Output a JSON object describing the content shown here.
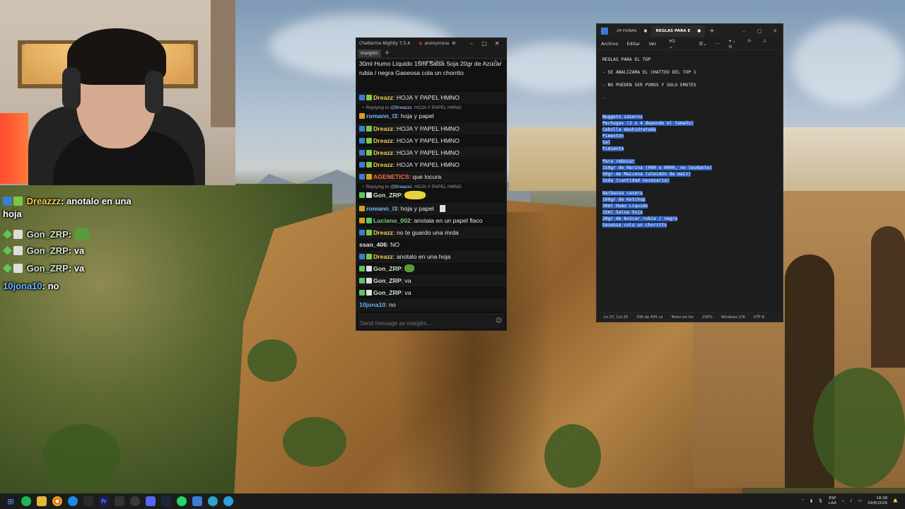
{
  "overlay_chat": {
    "lines": [
      {
        "user": "Dreazzz",
        "text": ": anotalo en una",
        "user_color": "#f0d050"
      },
      {
        "text": "hoja"
      },
      {
        "user": "Gon_ZRP",
        "text": ":",
        "user_color": "#cfe8cf"
      },
      {
        "user": "Gon_ZRP",
        "text": ": va",
        "user_color": "#cfe8cf"
      },
      {
        "user": "Gon_ZRP",
        "text": ": va",
        "user_color": "#cfe8cf"
      },
      {
        "user": "10jona10",
        "text": ": no",
        "user_color": "#6ab0ff"
      }
    ]
  },
  "chatterino": {
    "title": "Chatterino Nightly 7.5.4",
    "account": "anonymous",
    "tab": "margiim",
    "channel_header": "margiim (live)",
    "pinned_text": "30ml Humo Líquido 15ml Salsa Soja 20gr de Azúcar rubia / negra Gaseosa cola un chorrito",
    "input_placeholder": "Send message as margiim...",
    "messages": [
      {
        "user": "Dreazz",
        "text": ": HOJA Y PAPEL HMNO",
        "color": "#f0d050"
      },
      {
        "reply_to": "@Dreazzz",
        "reply_text": "HOJA Y PAPEL HMNO"
      },
      {
        "user": "romann_l3",
        "text": ": hoja y papel",
        "color": "#7ab8ff"
      },
      {
        "user": "Dreazz",
        "text": ": HOJA Y PAPEL HMNO",
        "color": "#f0d050"
      },
      {
        "user": "Dreazz",
        "text": ": HOJA Y PAPEL HMNO",
        "color": "#f0d050"
      },
      {
        "user": "Dreazz",
        "text": ": HOJA Y PAPEL HMNO",
        "color": "#f0d050"
      },
      {
        "user": "Dreazz",
        "text": ": HOJA Y PAPEL HMNO",
        "color": "#f0d050"
      },
      {
        "user": "AGENETICS",
        "text": ": que locura",
        "color": "#ff6a3d"
      },
      {
        "reply_to": "@Dreazzz",
        "reply_text": "HOJA Y PAPEL HMNO"
      },
      {
        "user": "Gon_ZRP",
        "text": ":",
        "color": "#cfe8cf"
      },
      {
        "user": "romann_l3",
        "text": ": hoja y papel",
        "color": "#7ab8ff"
      },
      {
        "user": "Luciano_002",
        "text": ": anotala en un papel flaco",
        "color": "#7fd07f"
      },
      {
        "user": "Dreazz",
        "text": ": no te guardo una mrda",
        "color": "#f0d050"
      },
      {
        "user": "ssan_406",
        "text": ": NO",
        "color": "#e6e6e6"
      },
      {
        "user": "Dreazz",
        "text": ": anotalo en una hoja",
        "color": "#f0d050"
      },
      {
        "user": "Gon_ZRP",
        "text": ":",
        "color": "#cfe8cf"
      },
      {
        "user": "Gon_ZRP",
        "text": ": va",
        "color": "#cfe8cf"
      },
      {
        "user": "Gon_ZRP",
        "text": ": va",
        "color": "#cfe8cf"
      },
      {
        "user": "10jona10",
        "text": ": no",
        "color": "#6ab0ff"
      }
    ]
  },
  "notepad": {
    "tabs": [
      "24 HORAS",
      "REGLAS PARA E"
    ],
    "menu": [
      "Archivo",
      "Editar",
      "Ver"
    ],
    "heading_level": "H1",
    "lines": [
      {
        "text": "REGLAS PARA EL TOP",
        "sel": false
      },
      {
        "text": "",
        "sel": false
      },
      {
        "text": "- SE ANALIZARA EL CHATTEO DEL TOP 1",
        "sel": false
      },
      {
        "text": "",
        "sel": false
      },
      {
        "text": "- NO PUEDEN SER PUROS Y SOLO EMOTES",
        "sel": false
      },
      {
        "text": "",
        "sel": false
      },
      {
        "text": "-",
        "sel": false
      },
      {
        "text": "",
        "sel": false
      },
      {
        "text": "",
        "sel": false
      },
      {
        "text": "Nuggets caseros",
        "sel": true
      },
      {
        "text": "Pechugas (3 o 4 depende el tamaño)",
        "sel": true
      },
      {
        "text": "Cebolla deshidratada",
        "sel": true
      },
      {
        "text": "Pimentón",
        "sel": true
      },
      {
        "text": "Sal",
        "sel": true
      },
      {
        "text": "Pimienta",
        "sel": true
      },
      {
        "text": "",
        "sel": true
      },
      {
        "text": "Para rebozar",
        "sel": true
      },
      {
        "text": "150gr de Harina (000 o 0000, no leudante)",
        "sel": true
      },
      {
        "text": "50gr de Maicena (almidón de maíz)",
        "sel": true
      },
      {
        "text": "Soda (cantidad necesaria)",
        "sel": true
      },
      {
        "text": "",
        "sel": true
      },
      {
        "text": "Barbacoa casera",
        "sel": true
      },
      {
        "text": "100gr de Ketchup",
        "sel": true
      },
      {
        "text": "30ml Humo Líquido",
        "sel": true
      },
      {
        "text": "15ml Salsa Soja",
        "sel": true
      },
      {
        "text": "20gr de Azúcar rubia / negra",
        "sel": true
      },
      {
        "text": "Gaseosa cola un chorrito",
        "sel": true
      }
    ],
    "status": [
      "Ln 27, Col 25",
      "336 de 435 ca",
      "Texto sin for",
      "100%",
      "Windows (CR",
      "UTF-8"
    ]
  },
  "taskbar": {
    "lang_top": "ESP",
    "lang_bottom": "LAA",
    "time": "18:38",
    "date": "29/8/2026"
  }
}
